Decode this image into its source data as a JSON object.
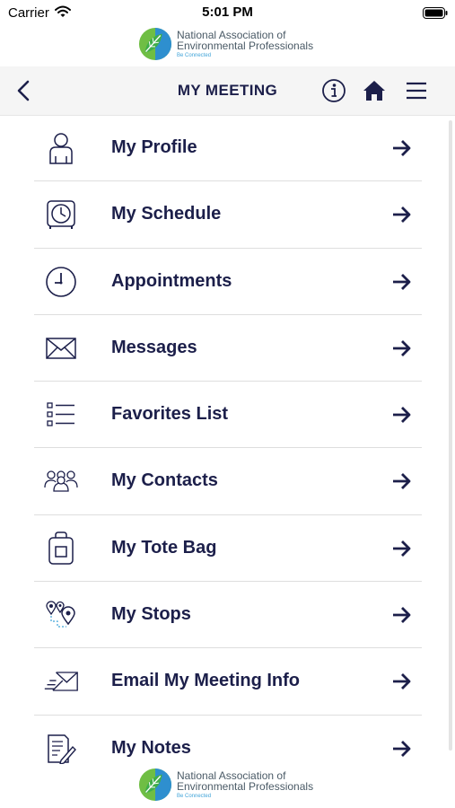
{
  "status_bar": {
    "carrier": "Carrier",
    "time": "5:01 PM"
  },
  "logo": {
    "line1": "National Association of",
    "line2": "Environmental Professionals",
    "tagline": "Be Connected"
  },
  "nav": {
    "title": "MY MEETING"
  },
  "menu": [
    {
      "label": "My Profile",
      "icon": "user-icon"
    },
    {
      "label": "My Schedule",
      "icon": "schedule-clock-icon"
    },
    {
      "label": "Appointments",
      "icon": "clock-icon"
    },
    {
      "label": "Messages",
      "icon": "envelope-icon"
    },
    {
      "label": "Favorites List",
      "icon": "list-icon"
    },
    {
      "label": "My Contacts",
      "icon": "contacts-icon"
    },
    {
      "label": "My Tote Bag",
      "icon": "tote-bag-icon"
    },
    {
      "label": "My Stops",
      "icon": "map-pins-icon"
    },
    {
      "label": "Email My Meeting Info",
      "icon": "send-email-icon"
    },
    {
      "label": "My Notes",
      "icon": "notes-icon"
    }
  ],
  "colors": {
    "primary_text": "#1c1f4a",
    "nav_background": "#f5f5f5",
    "divider": "#dedede",
    "logo_green": "#6fbe44",
    "logo_blue": "#3fa3d8"
  }
}
